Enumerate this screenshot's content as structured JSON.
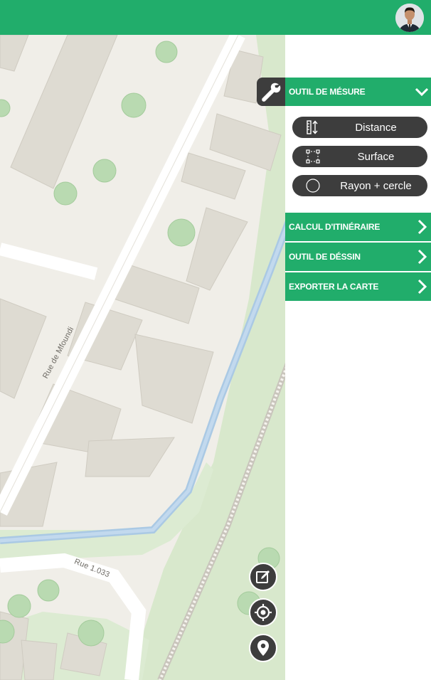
{
  "header": {
    "avatar_label": "user avatar"
  },
  "map": {
    "streets": [
      {
        "label": "Rue de Mfoundi"
      },
      {
        "label": "Rue 1.033"
      }
    ]
  },
  "panel": {
    "measure": {
      "title": "OUTIL DE MÉSURE",
      "tools": [
        {
          "label": "Distance",
          "icon": "ruler-icon"
        },
        {
          "label": "Surface",
          "icon": "area-square-icon"
        },
        {
          "label": "Rayon + cercle",
          "icon": "circle-icon"
        }
      ]
    },
    "sections": [
      {
        "title": "CALCUL D'ITINÉRAIRE"
      },
      {
        "title": "OUTIL DE DÉSSIN"
      },
      {
        "title": "EXPORTER LA CARTE"
      }
    ]
  },
  "colors": {
    "accent": "#21ad6b",
    "dark_button": "#3d3d3d"
  }
}
